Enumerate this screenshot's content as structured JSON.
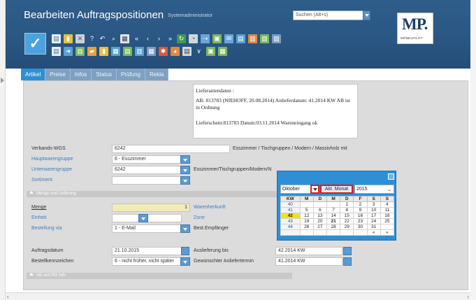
{
  "header": {
    "title": "Bearbeiten Auftragspositionen",
    "user": "Systemadministrator",
    "search_value": "Suchen (Alt+s)",
    "logo_text": "MP.",
    "logo_subtext": "MÖBELPILOT"
  },
  "toolbar": {
    "icons": [
      "new-icon",
      "attach-icon",
      "delete-icon",
      "help-icon",
      "undo-icon",
      "search-icon",
      "print-icon",
      "first-icon",
      "prev-icon",
      "next-icon",
      "last-icon",
      "refresh-icon",
      "lock-icon",
      "export-icon",
      "copy-icon",
      "email-icon",
      "image-icon",
      "filter-icon",
      "settings-icon"
    ],
    "colors": {
      "accent": "#4aa3df",
      "header": "#2f5d8a"
    }
  },
  "tabs": [
    "Artikel",
    "Preise",
    "Infos",
    "Status",
    "Prüfung",
    "Rekla"
  ],
  "memo": {
    "line1": "Lieferantendaten :",
    "line2": "AB: 813783    (NIEHOFF, 20.08.2014)    Anlieferdatum: 41.2014 KW AB ist in Ordnung",
    "line3": "Lieferschein:813783 Datum:03.11.2014 Wareneingang ok"
  },
  "form": {
    "verbands_label": "Verbands-WGS",
    "verbands_value": "6242",
    "verbands_desc": "Esszimmer / Tischgruppen / Modern / Massivholz mit",
    "hauptwarengruppe_label": "Hauptwarengruppe",
    "hauptwarengruppe_value": "6 - Esszimmer",
    "unterwarengruppe_label": "Unterwarengruppe",
    "unterwarengruppe_value": "6242",
    "unterwarengruppe_desc": "Esszimmer/Tischgruppen/Modern/N",
    "sortiment_label": "Sortiment",
    "section_menge": "Menge und Lieferung",
    "menge_label": "Menge",
    "menge_value": "1",
    "einheit_label": "Einheit",
    "bestellung_label": "Bestellung via",
    "bestellung_value": "1 - E-Mail",
    "warenherkunft_label": "Warenherkunft",
    "zone_label": "Zone",
    "empfaenger_label": "Best.Empfänger",
    "auftragsdatum_label": "Auftragsdatum",
    "auftragsdatum_value": "21.10.2015",
    "bestellkennzeichen_label": "Bestellkennzeichen",
    "bestellkennzeichen_value": "6 - nicht früher, nicht später",
    "auslieferung_label": "Auslieferung bis",
    "auslieferung_value": "42.2014 KW",
    "anliefertermin_label": "Gewünschter Anliefertermin",
    "anliefertermin_value": "41.2014 KW",
    "section_ab": "AB und RG Info"
  },
  "calendar": {
    "month": "Oktober",
    "today_button": "Akt. Monat",
    "year": "2015",
    "headers": [
      "KW",
      "M",
      "D",
      "M",
      "D",
      "F",
      "S",
      "S"
    ],
    "weeks": [
      [
        "40",
        "",
        "",
        "",
        "1",
        "2",
        "3",
        "4"
      ],
      [
        "41",
        "5",
        "6",
        "7",
        "8",
        "9",
        "10",
        "11"
      ],
      [
        "42",
        "12",
        "13",
        "14",
        "15",
        "16",
        "17",
        "18"
      ],
      [
        "43",
        "19",
        "20",
        "21",
        "22",
        "23",
        "24",
        "25"
      ],
      [
        "44",
        "26",
        "27",
        "28",
        "29",
        "30",
        "31",
        ""
      ]
    ],
    "nav_prev": "«",
    "nav_next": "»"
  }
}
